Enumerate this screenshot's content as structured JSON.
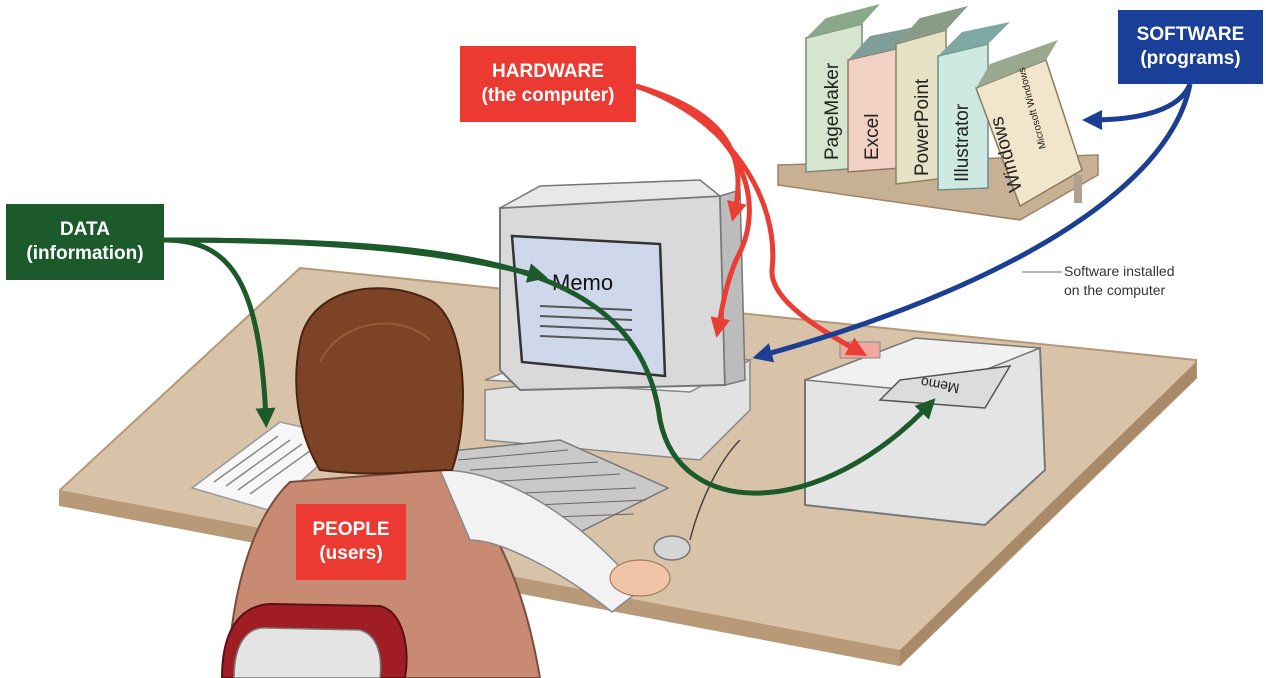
{
  "labels": {
    "hardware": {
      "line1": "HARDWARE",
      "line2": "(the computer)",
      "color": "#ec3a33"
    },
    "software": {
      "line1": "SOFTWARE",
      "line2": "(programs)",
      "color": "#1a3f98"
    },
    "data": {
      "line1": "DATA",
      "line2": "(information)",
      "color": "#1c5a2c"
    },
    "people": {
      "line1": "PEOPLE",
      "line2": "(users)",
      "color": "#ec3a33"
    }
  },
  "caption": {
    "line1": "Software installed",
    "line2": "on the computer"
  },
  "books": [
    "PageMaker",
    "Excel",
    "PowerPoint",
    "Illustrator",
    "Windows",
    "Microsoft Windows"
  ],
  "screen_text": "Memo",
  "printer_paper_text": "Memo",
  "colors": {
    "hardware_arrow": "#ea3e35",
    "software_arrow": "#1c3f94",
    "data_arrow": "#1c5a2c",
    "desk": "#d9c3a8",
    "monitor": "#dcdcdc",
    "screen": "#cfd8ea"
  }
}
